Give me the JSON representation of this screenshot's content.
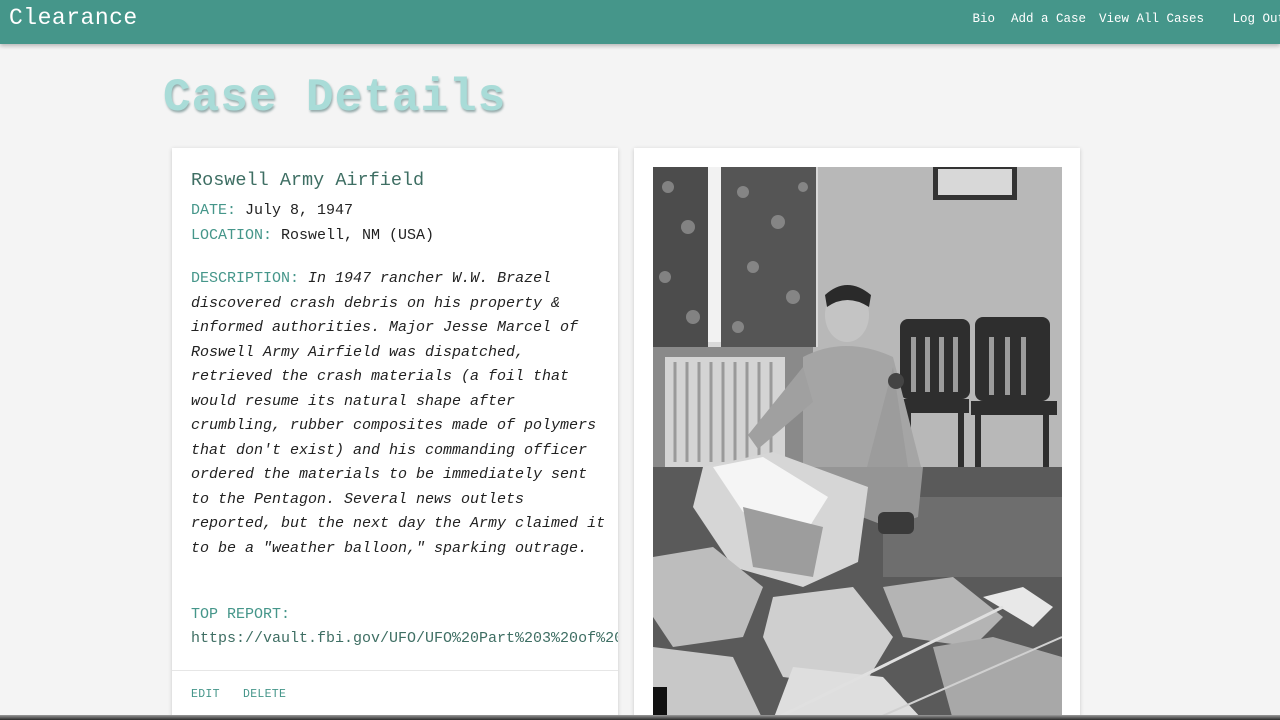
{
  "nav": {
    "brand": "Clearance",
    "links": [
      "Bio",
      "Add a Case",
      "View All Cases",
      "Log Out"
    ]
  },
  "page": {
    "title": "Case Details"
  },
  "case": {
    "title": "Roswell Army Airfield",
    "date_label": "DATE:",
    "date": "July 8, 1947",
    "location_label": "LOCATION:",
    "location": "Roswell, NM (USA)",
    "description_label": "DESCRIPTION:",
    "description": "In 1947 rancher W.W. Brazel discovered crash debris on his property & informed authorities. Major Jesse Marcel of Roswell Army Airfield was dispatched, retrieved the crash materials (a foil that would resume its natural shape after crumbling, rubber composites made of polymers that don't exist) and his commanding officer ordered the materials to be immediately sent to the Pentagon. Several news outlets reported, but the next day the Army claimed it to be a \"weather balloon,\" sparking outrage.",
    "report_label": "TOP REPORT:",
    "report_url": "https://vault.fbi.gov/UFO/UFO%20Part%203%20of%20",
    "actions": {
      "edit": "EDIT",
      "delete": "DELETE"
    }
  },
  "photo": {
    "subject": "black-and-white photo of officer kneeling beside foil crash debris"
  },
  "colors": {
    "nav": "#45968a",
    "accent": "#45968a",
    "title": "#a9dcd8",
    "background": "#f4f4f4"
  }
}
